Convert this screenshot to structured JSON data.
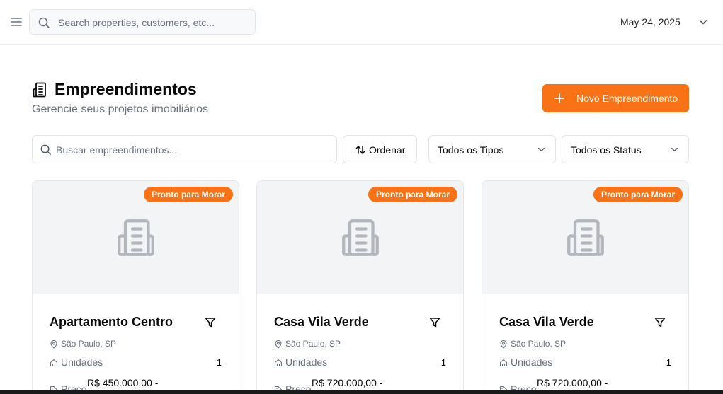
{
  "topbar": {
    "search_placeholder": "Search properties, customers, etc...",
    "date": "May 24, 2025"
  },
  "header": {
    "title": "Empreendimentos",
    "subtitle": "Gerencie seus projetos imobiliários",
    "new_button_label": "Novo Empreendimento"
  },
  "filters": {
    "search_placeholder": "Buscar empreendimentos...",
    "sort_label": "Ordenar",
    "type_select": "Todos os Tipos",
    "status_select": "Todos os Status"
  },
  "cards": [
    {
      "badge": "Pronto para Morar",
      "title": "Apartamento Centro",
      "location": "São Paulo, SP",
      "units_label": "Unidades",
      "units_value": "1",
      "price_label": "Preço",
      "price_value": "R$ 450.000,00 -"
    },
    {
      "badge": "Pronto para Morar",
      "title": "Casa Vila Verde",
      "location": "São Paulo, SP",
      "units_label": "Unidades",
      "units_value": "1",
      "price_label": "Preço",
      "price_value": "R$ 720.000,00 -"
    },
    {
      "badge": "Pronto para Morar",
      "title": "Casa Vila Verde",
      "location": "São Paulo, SP",
      "units_label": "Unidades",
      "units_value": "1",
      "price_label": "Preço",
      "price_value": "R$ 720.000,00 -"
    }
  ],
  "colors": {
    "accent": "#f97316",
    "muted_text": "#6b7280",
    "border": "#e3e5e8",
    "media_bg": "#f3f4f6"
  },
  "icons": [
    "menu-icon",
    "search-icon",
    "chevron-down-icon",
    "building-icon",
    "plus-icon",
    "sort-icon",
    "filter-icon",
    "map-pin-icon",
    "home-icon",
    "tag-icon"
  ]
}
